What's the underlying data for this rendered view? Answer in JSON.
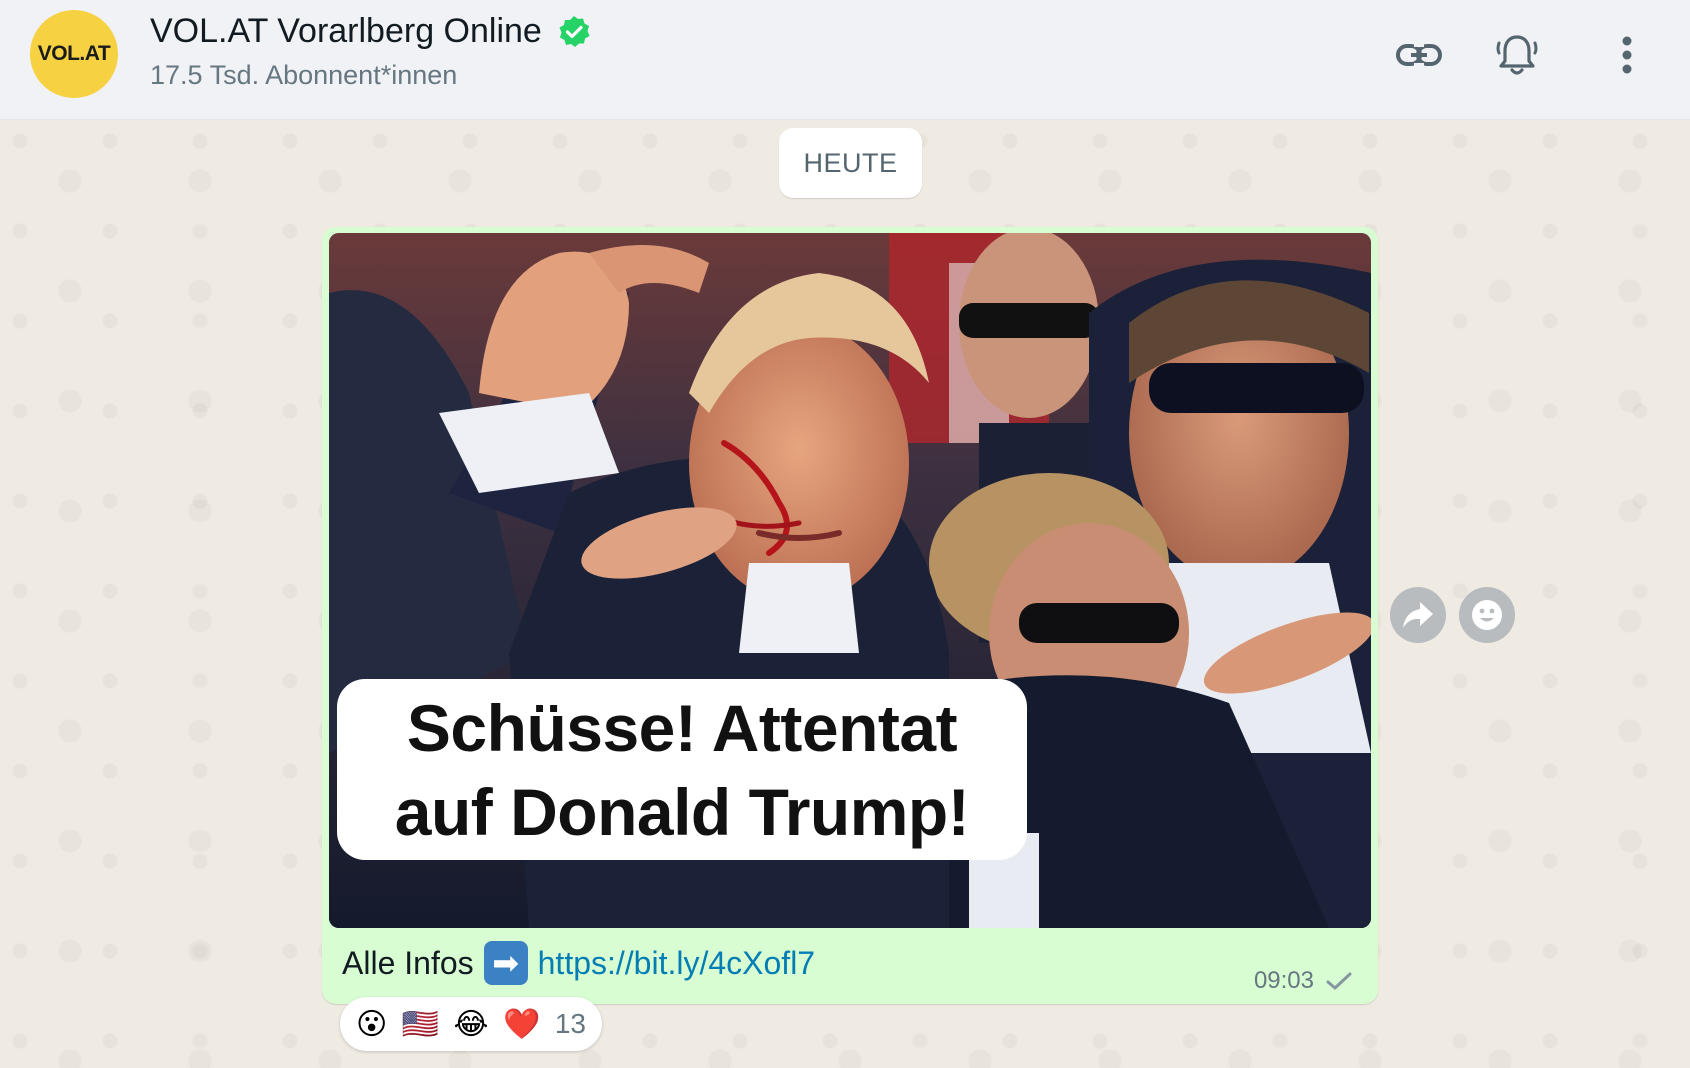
{
  "channel": {
    "avatar_text": "VOL.AT",
    "name": "VOL.AT Vorarlberg Online",
    "subscribers": "17.5 Tsd. Abonnent*innen",
    "verified": true
  },
  "header_actions": {
    "icons": [
      "link-icon",
      "bell-icon",
      "menu-icon"
    ]
  },
  "chat": {
    "day_label": "HEUTE"
  },
  "message": {
    "image_headline_line1": "Schüsse! Attentat",
    "image_headline_line2": "auf Donald Trump!",
    "caption_prefix": "Alle Infos",
    "caption_emoji": "➡",
    "link": "https://bit.ly/4cXofl7",
    "time": "09:03",
    "status": "sent"
  },
  "reactions": {
    "emojis": [
      "😮",
      "🇺🇸",
      "😂",
      "❤️"
    ],
    "count": "13"
  },
  "colors": {
    "header_bg": "#f0f2f5",
    "bubble_bg": "#d9fdd3",
    "chat_bg": "#efeae2",
    "avatar_bg": "#f6d243",
    "verified_green": "#25d366",
    "link_color": "#027eb5"
  }
}
